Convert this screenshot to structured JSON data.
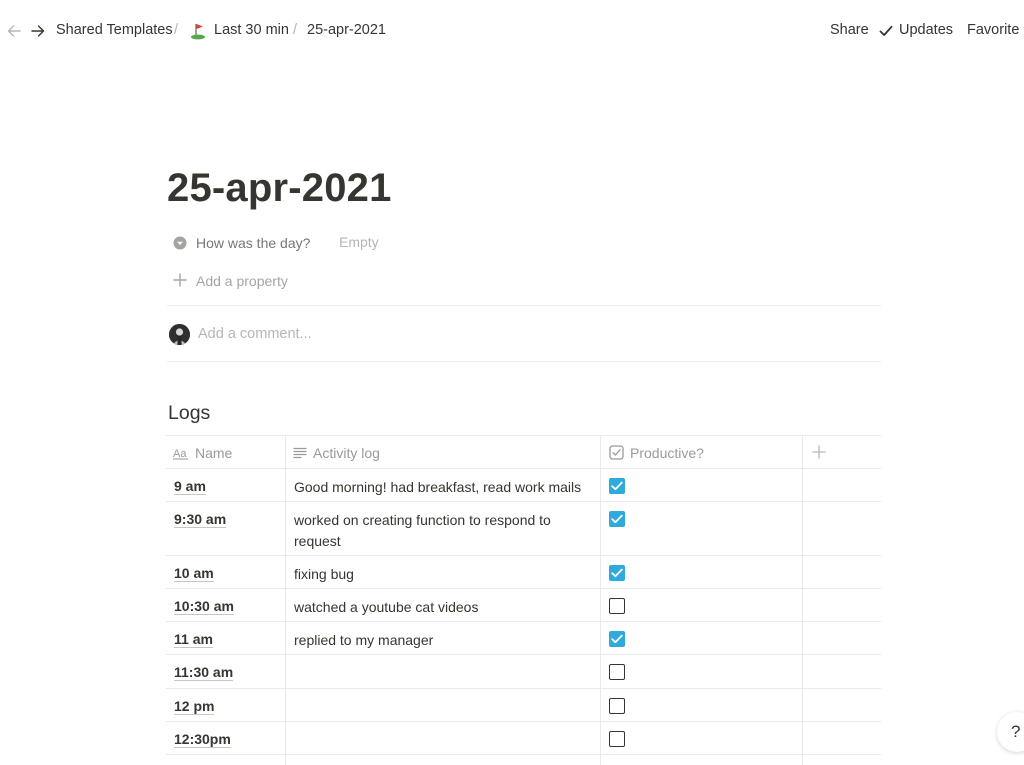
{
  "breadcrumb": {
    "items": [
      "Shared Templates",
      "Last 30 min",
      "25-apr-2021"
    ],
    "separator": "/"
  },
  "topbar": {
    "share": "Share",
    "updates": "Updates",
    "favorite": "Favorite"
  },
  "page": {
    "title": "25-apr-2021"
  },
  "properties": {
    "day_label": "How was the day?",
    "day_value": "Empty",
    "add_property": "Add a property"
  },
  "comment": {
    "placeholder": "Add a comment..."
  },
  "logs": {
    "title": "Logs",
    "columns": [
      "Name",
      "Activity log",
      "Productive?"
    ],
    "rows": [
      {
        "name": "9 am",
        "activity": "Good morning! had breakfast, read work mails",
        "productive": true
      },
      {
        "name": "9:30 am",
        "activity": "worked on creating function to respond to request",
        "productive": true
      },
      {
        "name": "10 am",
        "activity": "fixing bug",
        "productive": true
      },
      {
        "name": "10:30 am",
        "activity": "watched a youtube cat videos",
        "productive": false
      },
      {
        "name": "11 am",
        "activity": "replied to my manager",
        "productive": true
      },
      {
        "name": "11:30 am",
        "activity": "",
        "productive": false
      },
      {
        "name": "12 pm",
        "activity": "",
        "productive": false
      },
      {
        "name": "12:30pm",
        "activity": "",
        "productive": false
      }
    ]
  },
  "help": {
    "label": "?"
  },
  "colors": {
    "text": "#37352f",
    "muted": "#9b9a97",
    "checkbox_on": "#2eaadc",
    "border": "#e9e9e7"
  }
}
